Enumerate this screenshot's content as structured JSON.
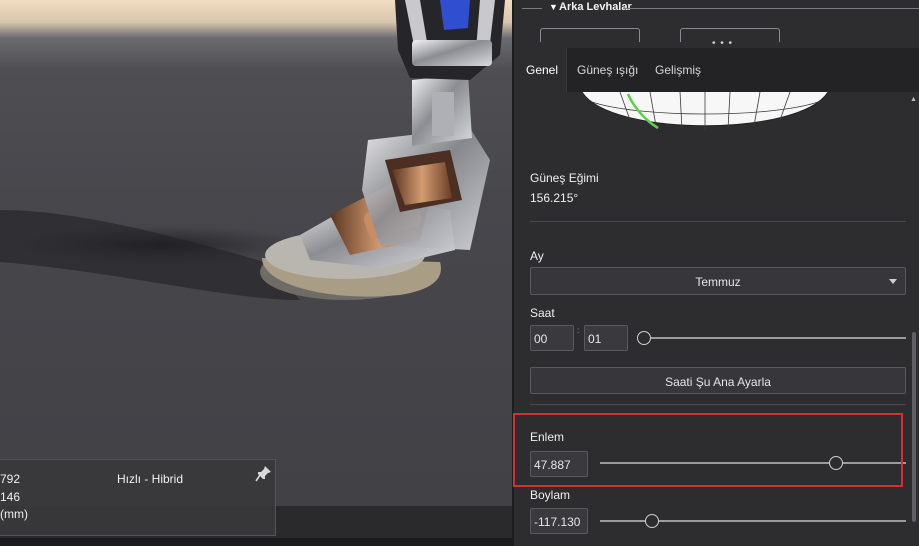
{
  "viewport": {
    "info_panel": {
      "line1": "792",
      "line2": "146",
      "line3": "(mm)",
      "render_mode": "Hızlı - Hibrid",
      "pin_icon": "pin-icon"
    }
  },
  "panel": {
    "section_title": "Arka Levhalar",
    "drag_handle": "• • •",
    "tabs": [
      {
        "label": "Genel",
        "active": true
      },
      {
        "label": "Güneş ışığı",
        "active": false
      },
      {
        "label": "Gelişmiş",
        "active": false
      }
    ],
    "sun_slope": {
      "label": "Güneş Eğimi",
      "value": "156.215°"
    },
    "month": {
      "label": "Ay",
      "selected": "Temmuz"
    },
    "time": {
      "label": "Saat",
      "hour": "00",
      "minute": "01",
      "separator": ":",
      "slider_fraction": 0.0
    },
    "set_now_button": "Saati Şu Ana Ayarla",
    "latitude": {
      "label": "Enlem",
      "value": "47.887",
      "slider_fraction": 0.77
    },
    "longitude": {
      "label": "Boylam",
      "value": "-117.130",
      "slider_fraction": 0.17
    },
    "colors": {
      "highlight": "#d72d35",
      "sun_arc": "#5fd04a"
    }
  }
}
